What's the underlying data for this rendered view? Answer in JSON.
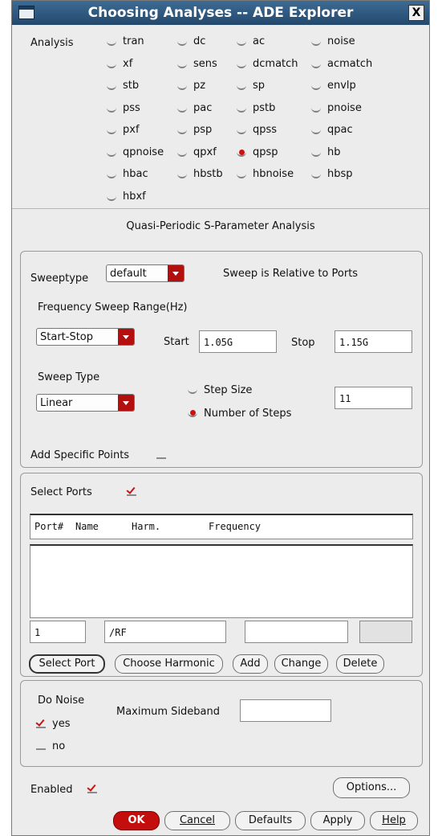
{
  "window": {
    "title": "Choosing Analyses -- ADE Explorer",
    "close_glyph": "X"
  },
  "analysis": {
    "label": "Analysis",
    "options": [
      {
        "label": "tran",
        "selected": false
      },
      {
        "label": "dc",
        "selected": false
      },
      {
        "label": "ac",
        "selected": false
      },
      {
        "label": "noise",
        "selected": false
      },
      {
        "label": "xf",
        "selected": false
      },
      {
        "label": "sens",
        "selected": false
      },
      {
        "label": "dcmatch",
        "selected": false
      },
      {
        "label": "acmatch",
        "selected": false
      },
      {
        "label": "stb",
        "selected": false
      },
      {
        "label": "pz",
        "selected": false
      },
      {
        "label": "sp",
        "selected": false
      },
      {
        "label": "envlp",
        "selected": false
      },
      {
        "label": "pss",
        "selected": false
      },
      {
        "label": "pac",
        "selected": false
      },
      {
        "label": "pstb",
        "selected": false
      },
      {
        "label": "pnoise",
        "selected": false
      },
      {
        "label": "pxf",
        "selected": false
      },
      {
        "label": "psp",
        "selected": false
      },
      {
        "label": "qpss",
        "selected": false
      },
      {
        "label": "qpac",
        "selected": false
      },
      {
        "label": "qpnoise",
        "selected": false
      },
      {
        "label": "qpxf",
        "selected": false
      },
      {
        "label": "qpsp",
        "selected": true
      },
      {
        "label": "hb",
        "selected": false
      },
      {
        "label": "hbac",
        "selected": false
      },
      {
        "label": "hbstb",
        "selected": false
      },
      {
        "label": "hbnoise",
        "selected": false
      },
      {
        "label": "hbsp",
        "selected": false
      },
      {
        "label": "hbxf",
        "selected": false
      }
    ]
  },
  "section_title": "Quasi-Periodic S-Parameter Analysis",
  "sweep": {
    "sweeptype_label": "Sweeptype",
    "sweeptype_value": "default",
    "relative_note": "Sweep is Relative to Ports",
    "freq_range_label": "Frequency Sweep Range(Hz)",
    "range_mode": "Start-Stop",
    "start_label": "Start",
    "start_value": "1.05G",
    "stop_label": "Stop",
    "stop_value": "1.15G",
    "type_label": "Sweep Type",
    "type_value": "Linear",
    "step_size_label": "Step Size",
    "num_steps_label": "Number of Steps",
    "num_steps_value": "11",
    "add_points_label": "Add Specific Points"
  },
  "ports": {
    "select_label": "Select Ports",
    "columns": [
      "Port#",
      "Name",
      "Harm.",
      "Frequency"
    ],
    "port_num_value": "1",
    "name_value": "/RF",
    "select_port_btn": "Select Port",
    "choose_harmonic_btn": "Choose Harmonic",
    "add_btn": "Add",
    "change_btn": "Change",
    "delete_btn": "Delete"
  },
  "noise": {
    "do_noise_label": "Do Noise",
    "yes_label": "yes",
    "no_label": "no",
    "max_sideband_label": "Maximum Sideband"
  },
  "footer": {
    "enabled_label": "Enabled",
    "options_btn": "Options...",
    "ok_btn": "OK",
    "cancel_btn": "Cancel",
    "defaults_btn": "Defaults",
    "apply_btn": "Apply",
    "help_btn": "Help"
  },
  "colors": {
    "accent_red": "#c40d0d",
    "title_blue": "#2f5a80",
    "dialog_bg": "#ececec"
  }
}
